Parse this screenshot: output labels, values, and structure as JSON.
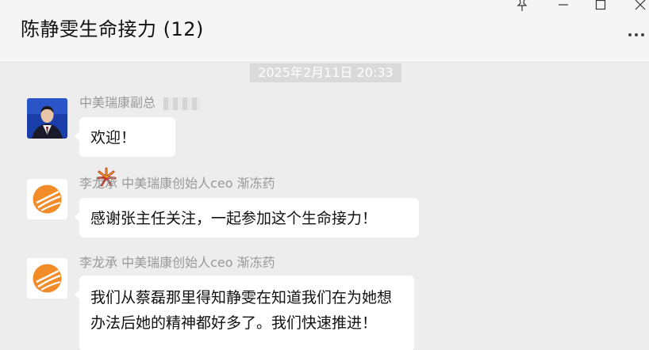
{
  "header": {
    "title": "陈静雯生命接力 (12)",
    "pin_icon": "pin-icon",
    "minimize_icon": "minimize-icon",
    "maximize_icon": "maximize-icon",
    "close_icon": "close-icon",
    "more_icon": "more-dots-icon"
  },
  "timestamp": "2025年2月11日 20:33",
  "messages": [
    {
      "sender": "中美瑞康副总",
      "avatar": "person-photo-avatar",
      "text": "欢迎！",
      "emoji": "firecracker-emoji"
    },
    {
      "sender": "李龙承 中美瑞康创始人ceo 渐冻药",
      "avatar": "orange-logo-avatar",
      "text": "感谢张主任关注，一起参加这个生命接力！"
    },
    {
      "sender": "李龙承 中美瑞康创始人ceo 渐冻药",
      "avatar": "orange-logo-avatar",
      "text_line1": "我们从蔡磊那里得知静雯在知道我们在为她想",
      "text_line2": "办法后她的精神都好多了。我们快速推进！"
    }
  ],
  "colors": {
    "background": "#ededed",
    "header_bg": "#f5f5f5",
    "bubble_bg": "#ffffff",
    "sender_text": "#999999",
    "timestamp_bg": "#dadada",
    "logo_orange": "#f28c28"
  }
}
